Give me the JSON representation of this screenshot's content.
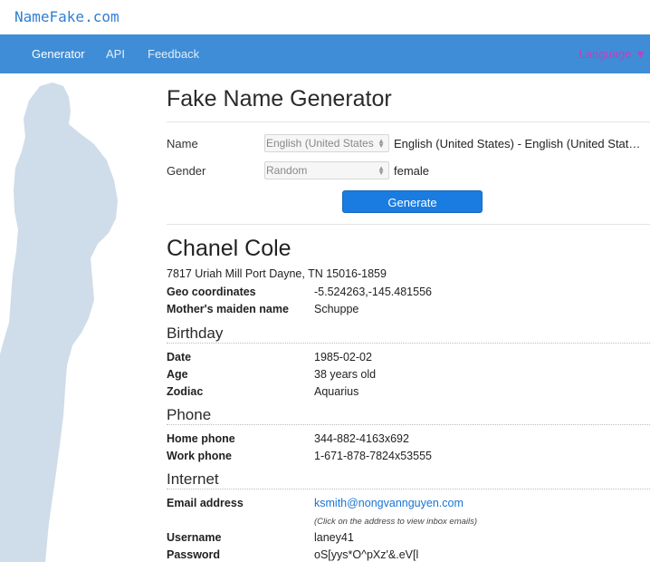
{
  "site": {
    "logo": "NameFake.com"
  },
  "nav": {
    "items": [
      {
        "label": "Generator"
      },
      {
        "label": "API"
      },
      {
        "label": "Feedback"
      }
    ],
    "language_label": "Language ▼",
    "colors": {
      "bar": "#3f8dd6",
      "language": "#c23fc2"
    }
  },
  "generator": {
    "title": "Fake Name Generator",
    "name_label": "Name",
    "name_select_value": "English (United States",
    "name_selected_text": "English (United States) - English (United Stat…",
    "gender_label": "Gender",
    "gender_select_value": "Random",
    "gender_selected_text": "female",
    "generate_label": "Generate"
  },
  "person": {
    "name": "Chanel Cole",
    "address": "7817 Uriah Mill Port Dayne, TN 15016-1859",
    "geo_label": "Geo coordinates",
    "geo_value": "-5.524263,-145.481556",
    "maiden_label": "Mother's maiden name",
    "maiden_value": "Schuppe"
  },
  "birthday": {
    "title": "Birthday",
    "date_label": "Date",
    "date_value": "1985-02-02",
    "age_label": "Age",
    "age_value": "38 years old",
    "zodiac_label": "Zodiac",
    "zodiac_value": "Aquarius"
  },
  "phone": {
    "title": "Phone",
    "home_label": "Home phone",
    "home_value": "344-882-4163x692",
    "work_label": "Work phone",
    "work_value": "1-671-878-7824x53555"
  },
  "internet": {
    "title": "Internet",
    "email_label": "Email address",
    "email_value": "ksmith@nongvannguyen.com",
    "email_note": "(Click on the address to view inbox emails)",
    "username_label": "Username",
    "username_value": "laney41",
    "password_label": "Password",
    "password_value": "oS[yys*O^pXz'&.eV[l"
  }
}
